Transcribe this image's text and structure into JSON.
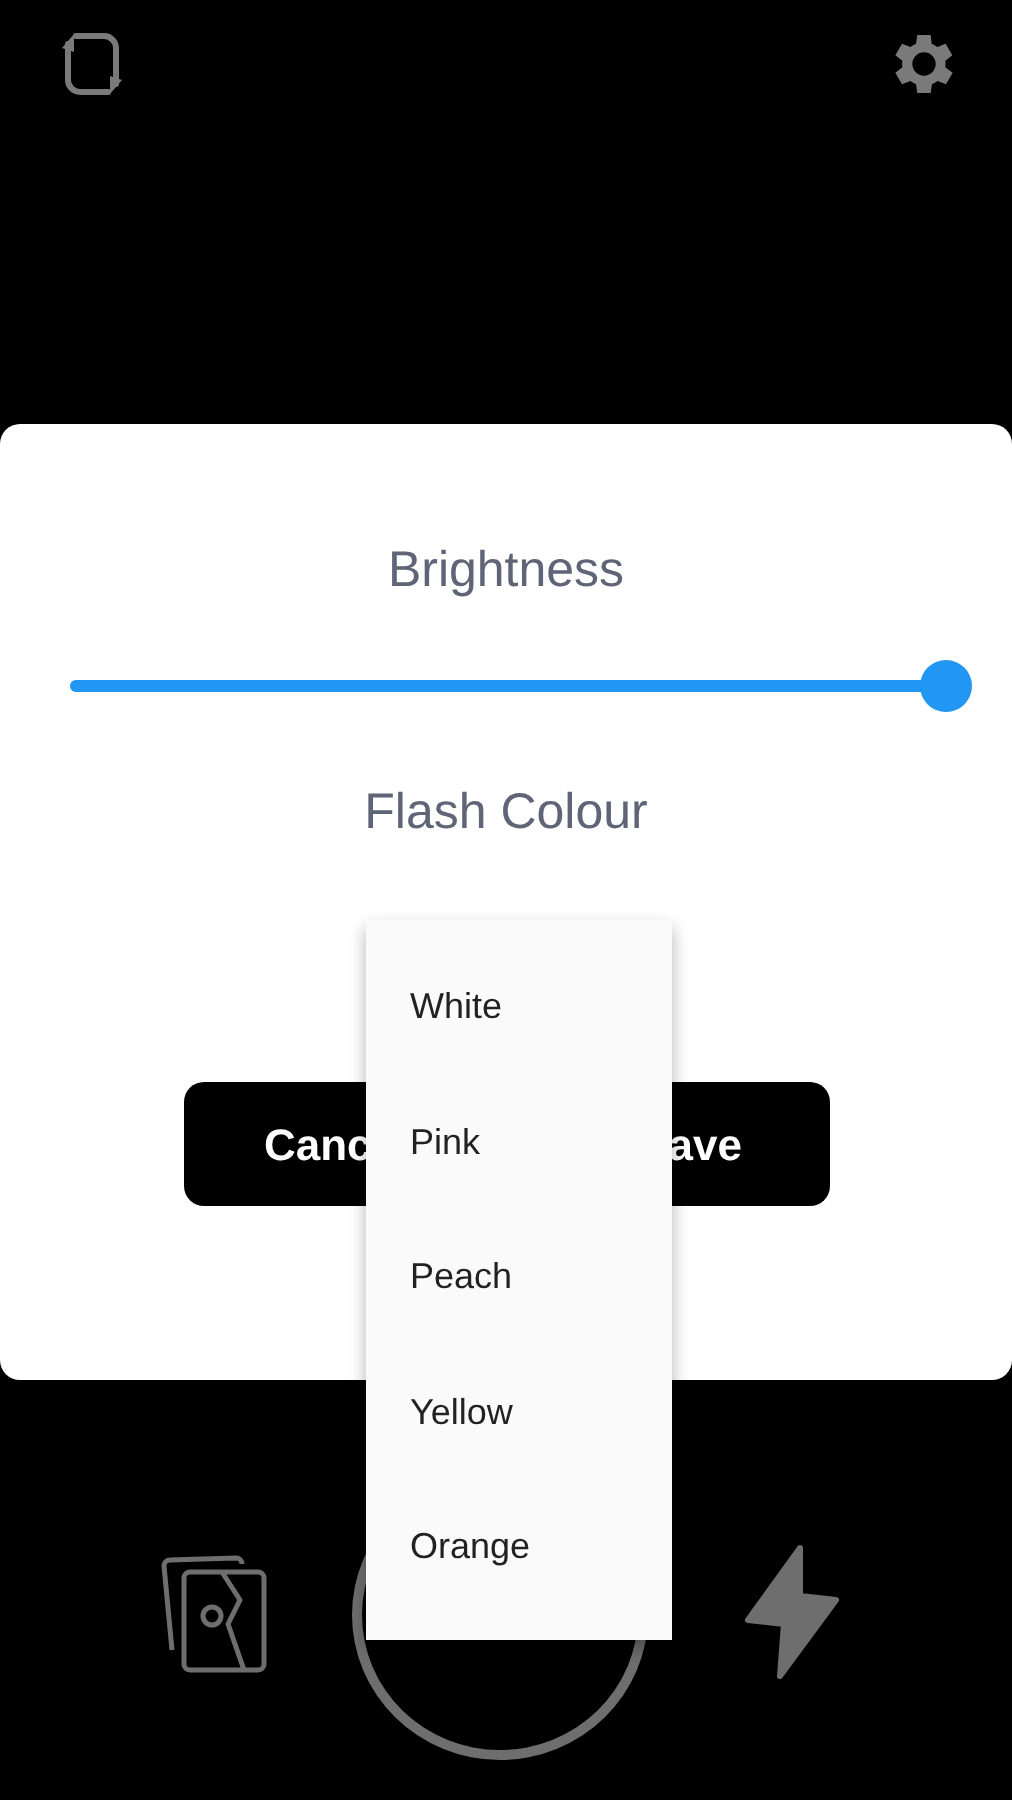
{
  "dialog": {
    "title": "Brightness",
    "brightness": {
      "level": 1.0
    },
    "subtitle": "Flash Colour",
    "buttons": [
      {
        "label": "Canc",
        "kind": "cancel"
      },
      {
        "label": "ave",
        "kind": "save"
      }
    ]
  },
  "menu": {
    "items": [
      {
        "label": "White"
      },
      {
        "label": "Pink"
      },
      {
        "label": "Peach"
      },
      {
        "label": "Yellow"
      },
      {
        "label": "Orange"
      }
    ]
  }
}
